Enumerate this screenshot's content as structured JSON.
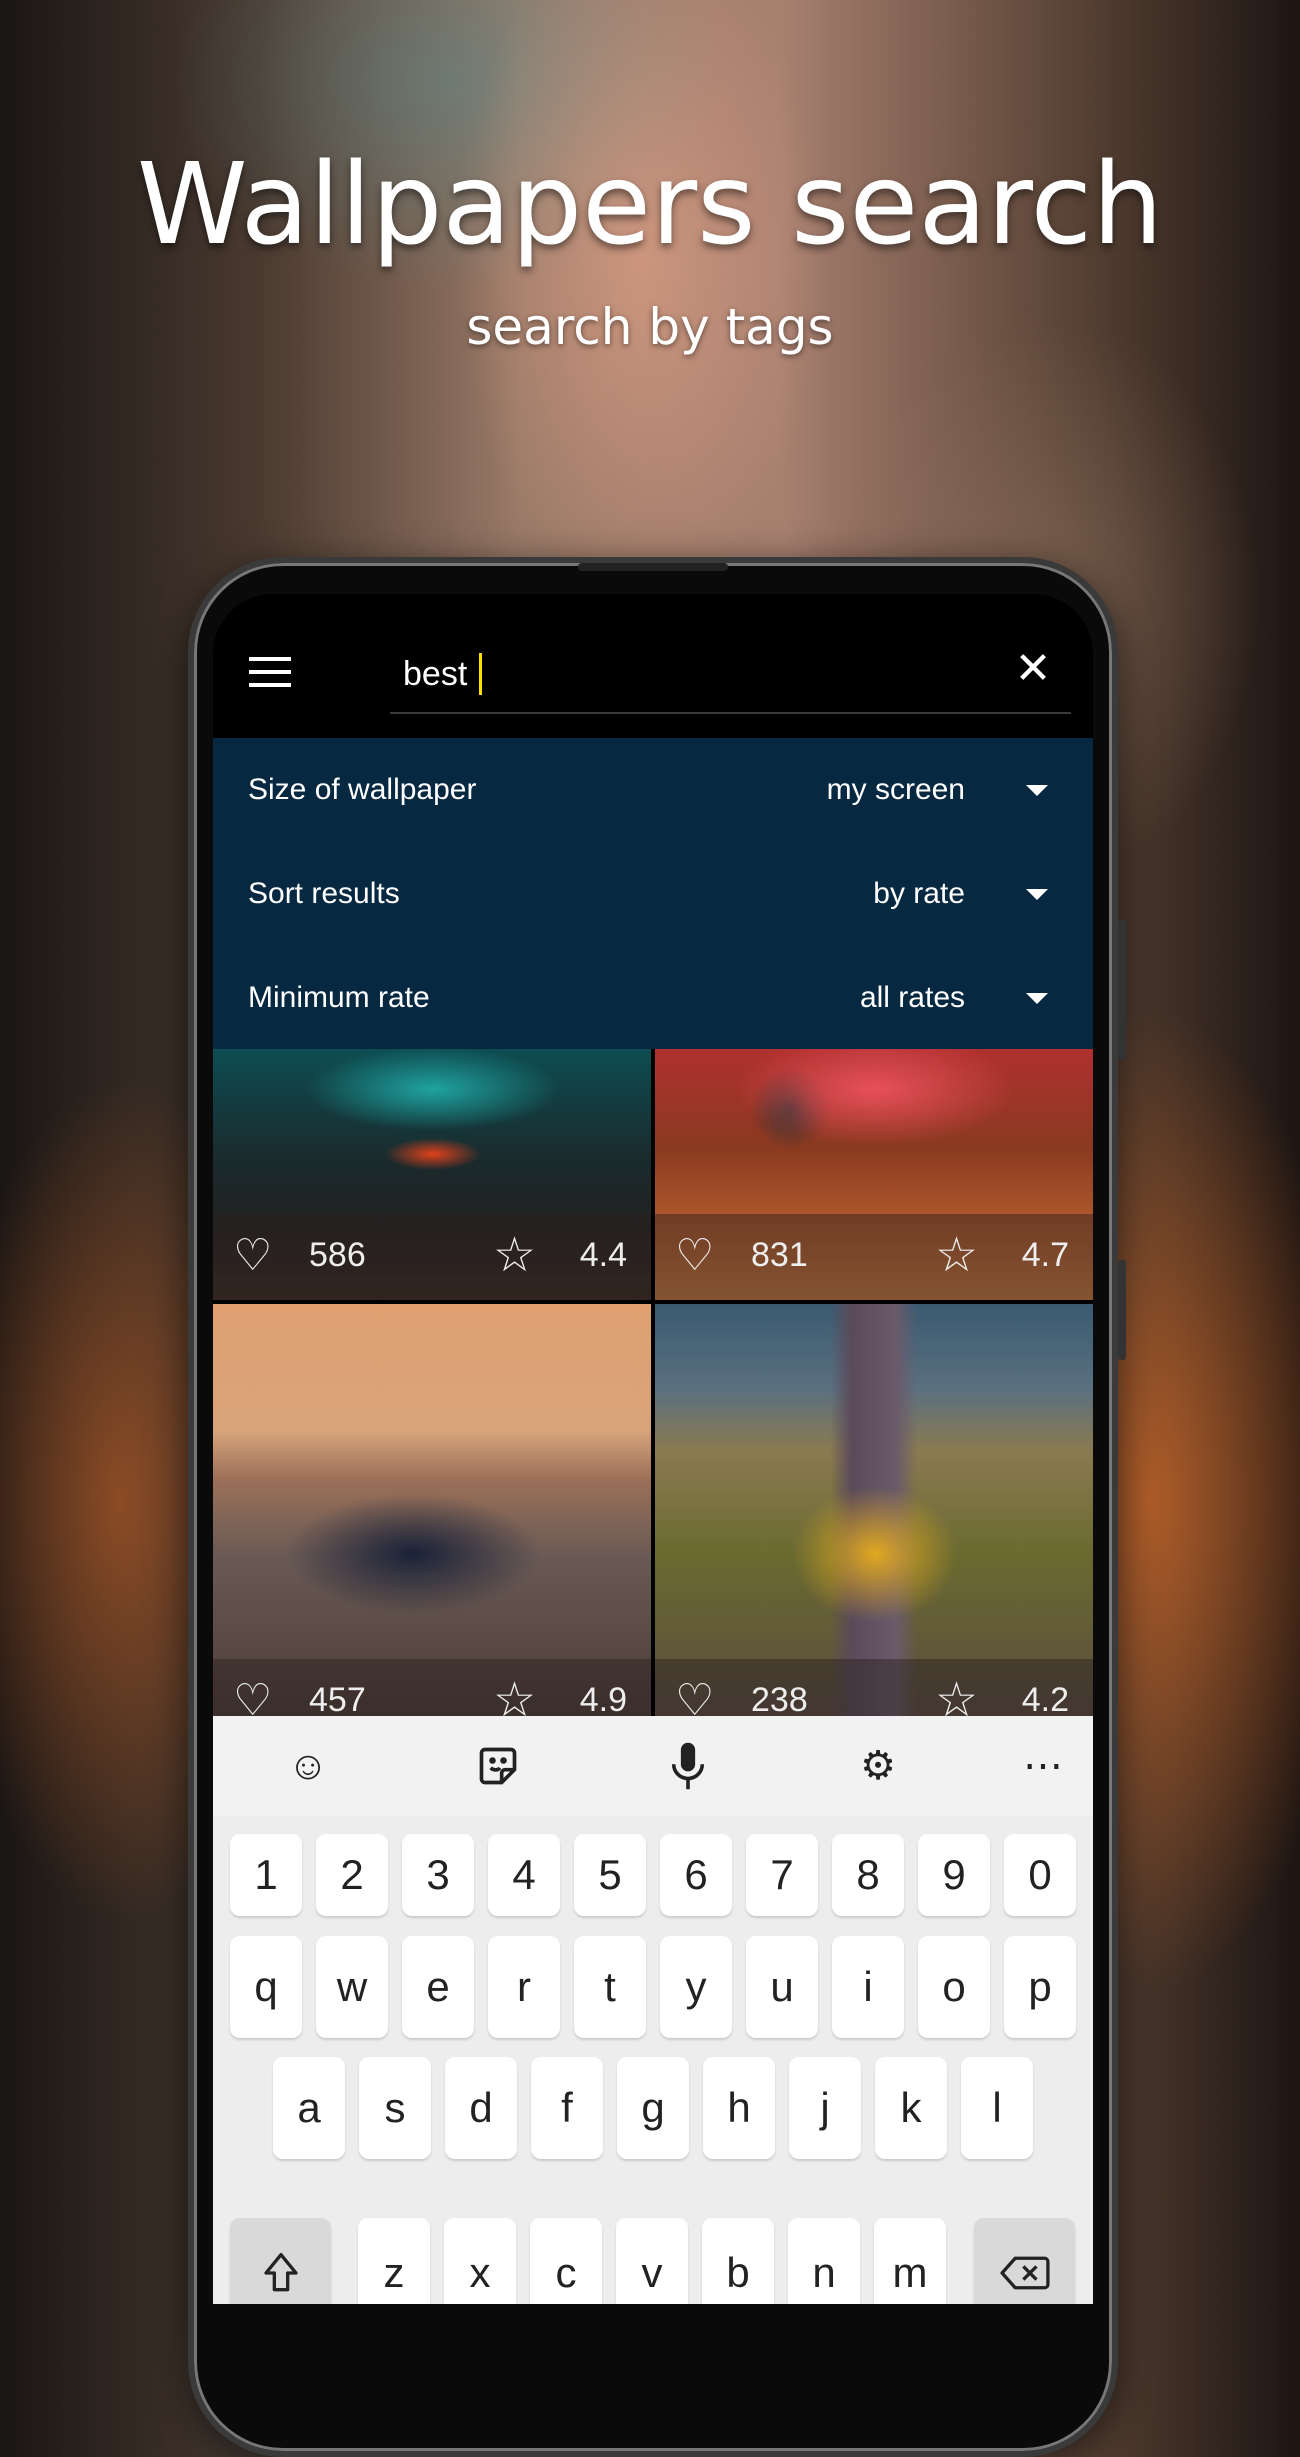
{
  "hero": {
    "title": "Wallpapers search",
    "subtitle": "search by tags"
  },
  "search": {
    "value": "best",
    "menu_icon": "hamburger-icon",
    "clear_icon": "close-icon"
  },
  "filters": [
    {
      "label": "Size of wallpaper",
      "value": "my screen"
    },
    {
      "label": "Sort results",
      "value": "by rate"
    },
    {
      "label": "Minimum rate",
      "value": "all rates"
    }
  ],
  "wallpapers": [
    {
      "likes": "586",
      "rate": "4.4"
    },
    {
      "likes": "831",
      "rate": "4.7"
    },
    {
      "likes": "457",
      "rate": "4.9"
    },
    {
      "likes": "238",
      "rate": "4.2"
    }
  ],
  "keyboard": {
    "toolbar": [
      "emoji-icon",
      "sticker-icon",
      "microphone-icon",
      "settings-icon",
      "more-icon"
    ],
    "rows": [
      [
        "1",
        "2",
        "3",
        "4",
        "5",
        "6",
        "7",
        "8",
        "9",
        "0"
      ],
      [
        "q",
        "w",
        "e",
        "r",
        "t",
        "y",
        "u",
        "i",
        "o",
        "p"
      ],
      [
        "a",
        "s",
        "d",
        "f",
        "g",
        "h",
        "j",
        "k",
        "l"
      ],
      [
        "z",
        "x",
        "c",
        "v",
        "b",
        "n",
        "m"
      ]
    ]
  },
  "colors": {
    "filter_panel": "#062840",
    "caret": "#ffe000",
    "keyboard_bg": "#ededed"
  }
}
